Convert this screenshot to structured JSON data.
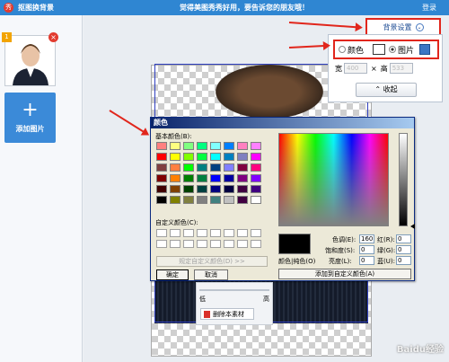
{
  "titlebar": {
    "title": "抠图换背景",
    "slogan": "觉得美图秀秀好用，要告诉您的朋友哦！",
    "login": "登录"
  },
  "sidebar": {
    "thumb_index": "1",
    "add_button": "添加图片"
  },
  "bg_settings": {
    "button": "背景设置",
    "color_option": "颜色",
    "picture_option": "图片",
    "width_label": "宽",
    "width_value": "400",
    "height_label": "高",
    "height_value": "533",
    "lock_symbol": "×",
    "collapse": "收起"
  },
  "color_dialog": {
    "title": "颜色",
    "basic_colors_label": "基本颜色(B):",
    "custom_colors_label": "自定义颜色(C):",
    "define_button": "规定自定义颜色(D) >>",
    "ok": "确定",
    "cancel": "取消",
    "hue_label": "色调(E):",
    "hue_value": "160",
    "sat_label": "饱和度(S):",
    "sat_value": "0",
    "lum_label": "亮度(L):",
    "lum_value": "0",
    "red_label": "红(R):",
    "red_value": "0",
    "green_label": "绿(G):",
    "green_value": "0",
    "blue_label": "蓝(U):",
    "blue_value": "0",
    "color_solid_label": "颜色|纯色(O)",
    "add_custom_button": "添加到自定义颜色(A)",
    "basic_colors": [
      "#ff8080",
      "#ffff80",
      "#80ff80",
      "#00ff80",
      "#80ffff",
      "#0080ff",
      "#ff80c0",
      "#ff80ff",
      "#ff0000",
      "#ffff00",
      "#80ff00",
      "#00ff40",
      "#00ffff",
      "#0080c0",
      "#8080c0",
      "#ff00ff",
      "#804040",
      "#ff8040",
      "#00ff00",
      "#008080",
      "#004080",
      "#8080ff",
      "#800040",
      "#ff0080",
      "#800000",
      "#ff8000",
      "#008000",
      "#008040",
      "#0000ff",
      "#0000a0",
      "#800080",
      "#8000ff",
      "#400000",
      "#804000",
      "#004000",
      "#004040",
      "#000080",
      "#000040",
      "#400040",
      "#400080",
      "#000000",
      "#808000",
      "#808040",
      "#808080",
      "#408080",
      "#c0c0c0",
      "#400040",
      "#ffffff"
    ]
  },
  "canvas": {
    "slider_left": "低",
    "slider_right": "高",
    "delete_button": "删除本素材"
  },
  "watermark": "Baidu经验"
}
